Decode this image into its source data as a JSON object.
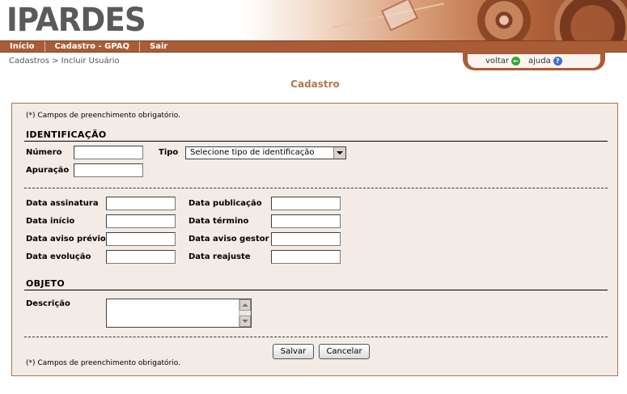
{
  "header": {
    "logo_text": "IPARDES"
  },
  "nav": {
    "items": [
      "Início",
      "Cadastro - GPAQ",
      "Sair"
    ]
  },
  "breadcrumb": "Cadastros > Incluir Usuário",
  "help": {
    "back_label": "voltar",
    "help_label": "ajuda"
  },
  "page_title": "Cadastro",
  "form": {
    "required_note": "(*) Campos de preenchimento obrigatório.",
    "identificacao": {
      "title": "IDENTIFICAÇÃO",
      "numero_label": "Número",
      "numero_value": "",
      "tipo_label": "Tipo",
      "tipo_selected": "Selecione tipo de identificação",
      "apuracao_label": "Apuração",
      "apuracao_value": ""
    },
    "datas": {
      "data_assinatura": "Data assinatura",
      "data_publicacao": "Data publicação",
      "data_inicio": "Data início",
      "data_termino": "Data término",
      "data_aviso_previo": "Data aviso prévio",
      "data_aviso_gestor": "Data aviso gestor",
      "data_evolucao": "Data evolução",
      "data_reajuste": "Data reajuste"
    },
    "objeto": {
      "title": "OBJETO",
      "descricao_label": "Descrição",
      "descricao_value": ""
    },
    "buttons": {
      "save": "Salvar",
      "cancel": "Cancelar"
    },
    "footer_note": "(*) Campos de preenchimento obrigatório."
  },
  "colors": {
    "nav_bg": "#a95d37",
    "panel_bg": "#f3ebe6",
    "title": "#b4774f"
  },
  "icons": {
    "back": "green-arrow-left-icon",
    "help": "blue-question-icon"
  }
}
